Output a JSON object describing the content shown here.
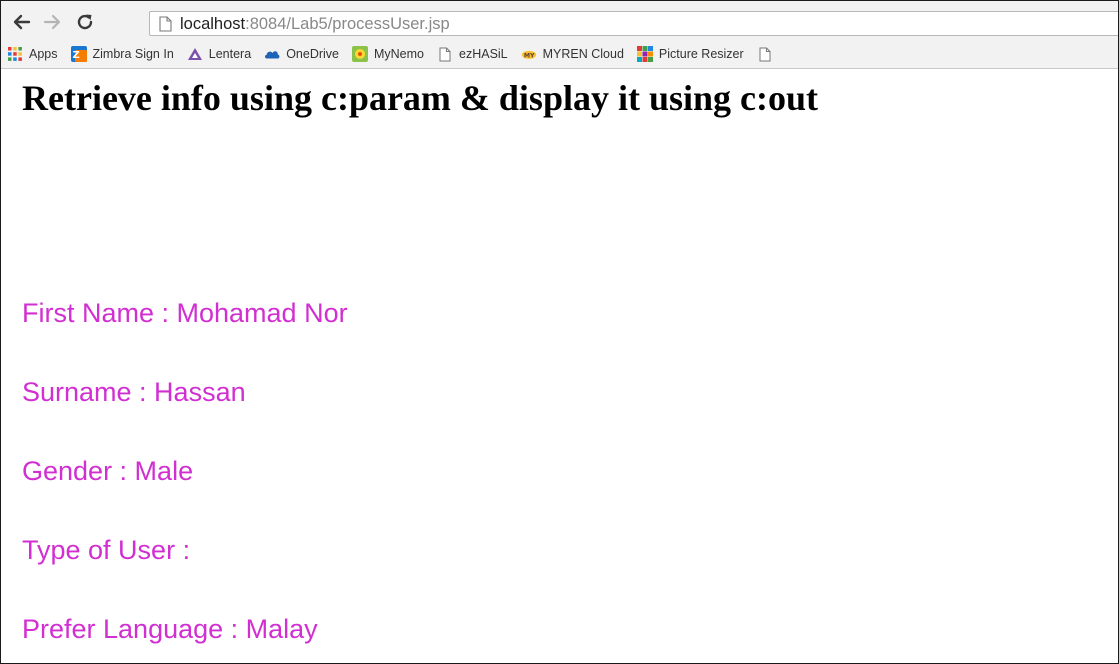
{
  "browser": {
    "url_host": "localhost",
    "url_path": ":8084/Lab5/processUser.jsp"
  },
  "bookmarks": [
    {
      "label": "Apps",
      "icon": "apps-grid-icon"
    },
    {
      "label": "Zimbra Sign In",
      "icon": "zimbra-icon"
    },
    {
      "label": "Lentera",
      "icon": "lentera-icon"
    },
    {
      "label": "OneDrive",
      "icon": "onedrive-icon"
    },
    {
      "label": "MyNemo",
      "icon": "mynemo-icon"
    },
    {
      "label": "ezHASiL",
      "icon": "page-icon"
    },
    {
      "label": "MYREN Cloud",
      "icon": "myren-icon"
    },
    {
      "label": "Picture Resizer",
      "icon": "picture-resizer-icon"
    }
  ],
  "page": {
    "title": "Retrieve info using c:param & display it using c:out",
    "fields": [
      "First Name : Mohamad Nor",
      "Surname : Hassan",
      "Gender : Male",
      "Type of User :",
      "Prefer Language : Malay"
    ]
  },
  "colors": {
    "field_text": "#d12fd1",
    "title_text": "#000000"
  }
}
